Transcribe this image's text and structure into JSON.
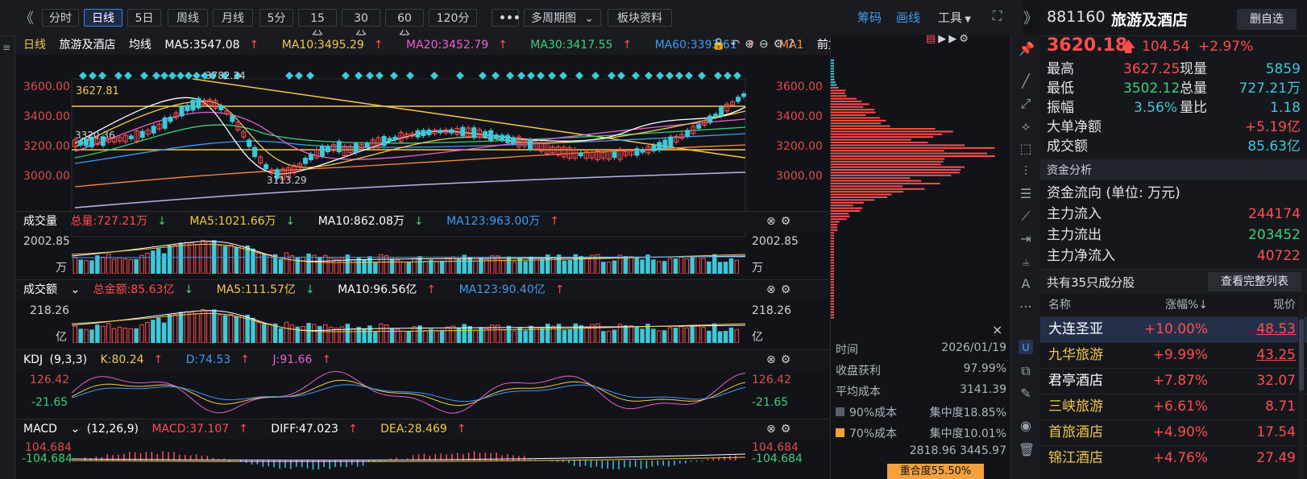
{
  "toolbar": {
    "period_tabs": [
      "分时",
      "日线",
      "5日",
      "周线",
      "月线",
      "5分",
      "15分",
      "30分",
      "60分",
      "120分"
    ],
    "active_tab": "日线",
    "more_label": "•••",
    "multi_period_label": "多周期图",
    "sector_info_label": "板块资料",
    "chips_label": "筹码",
    "drawline_label": "画线",
    "tools_label": "工具"
  },
  "main_chart": {
    "period_label": "日线",
    "name": "旅游及酒店",
    "ma_mode_label": "均线",
    "ma": [
      {
        "label": "MA5:3547.08",
        "color": "#ffffff"
      },
      {
        "label": "MA10:3495.29",
        "color": "#f2c94c"
      },
      {
        "label": "MA20:3452.79",
        "color": "#e960d2"
      },
      {
        "label": "MA30:3417.55",
        "color": "#3cd07a"
      },
      {
        "label": "MA60:3393.61",
        "color": "#3e9bf0"
      },
      {
        "label": "MA1",
        "color": "#ff8a3c"
      }
    ],
    "adjust_label": "前复权",
    "price_axis": [
      "3600.00",
      "3400.00",
      "3200.00",
      "3000.00"
    ],
    "high_annot": "3782.24",
    "low_annot": "3113.29",
    "hline_label": "3627.81",
    "left_annot": "3320.36"
  },
  "volume_panel": {
    "title": "成交量",
    "total": "总量:727.21万",
    "ma5": "MA5:1021.66万",
    "ma10": "MA10:862.08万",
    "ma123": "MA123:963.00万",
    "axis_top": "2002.85",
    "axis_unit": "万"
  },
  "amount_panel": {
    "title": "成交额",
    "total": "总金额:85.63亿",
    "ma5": "MA5:111.57亿",
    "ma10": "MA10:96.56亿",
    "ma123": "MA123:90.40亿",
    "axis_top": "218.26",
    "axis_unit": "亿"
  },
  "kdj_panel": {
    "title": "KDJ",
    "params": "(9,3,3)",
    "k": "K:80.24",
    "d": "D:74.53",
    "j": "J:91.66",
    "axis_top": "126.42",
    "axis_bottom": "-21.65"
  },
  "macd_panel": {
    "title": "MACD",
    "params": "(12,26,9)",
    "macd": "MACD:37.107",
    "diff": "DIFF:47.023",
    "dea": "DEA:28.469",
    "axis_top": "104.684",
    "axis_bottom": "-104.684"
  },
  "chip_panel": {
    "close_label": "×",
    "time_label": "时间",
    "time_value": "2026/01/19",
    "profit_label": "收盘获利",
    "profit_value": "97.99%",
    "avg_cost_label": "平均成本",
    "avg_cost_value": "3141.39",
    "cost90_label": "90%成本",
    "cost90_value": "集中度18.85%",
    "cost70_label": "70%成本",
    "cost70_value": "集中度10.01%",
    "range_value": "2818.96 3445.97",
    "overlap_value": "重合度55.50%"
  },
  "quote": {
    "code": "881160",
    "name": "旅游及酒店",
    "del_fav_label": "删自选",
    "price": "3620.18",
    "change": "104.54",
    "pct": "+2.97%",
    "stats": [
      {
        "k": "最高",
        "v": "3627.25",
        "k2": "现量",
        "v2": "5859"
      },
      {
        "k": "最低",
        "v": "3502.12",
        "k2": "总量",
        "v2": "727.21万"
      },
      {
        "k": "振幅",
        "v": "3.56%",
        "k2": "量比",
        "v2": "1.18"
      }
    ],
    "net_big_label": "大单净额",
    "net_big_value": "+5.19亿",
    "turnover_label": "成交额",
    "turnover_value": "85.63亿"
  },
  "fund": {
    "tab_label": "资金分析",
    "flow_title": "资金流向 (单位: 万元)",
    "inflow_label": "主力流入",
    "inflow_value": "244174",
    "outflow_label": "主力流出",
    "outflow_value": "203452",
    "net_label": "主力净流入",
    "net_value": "40722"
  },
  "constituents": {
    "count_label": "共有35只成分股",
    "view_all_label": "查看完整列表",
    "col_name": "名称",
    "col_pct": "涨幅%",
    "col_price": "现价",
    "rows": [
      {
        "name": "大连圣亚",
        "pct": "+10.00%",
        "price": "48.53"
      },
      {
        "name": "九华旅游",
        "pct": "+9.99%",
        "price": "43.25"
      },
      {
        "name": "君亭酒店",
        "pct": "+7.87%",
        "price": "32.07"
      },
      {
        "name": "三峡旅游",
        "pct": "+6.61%",
        "price": "8.71"
      },
      {
        "name": "首旅酒店",
        "pct": "+4.90%",
        "price": "17.54"
      },
      {
        "name": "锦江酒店",
        "pct": "+4.76%",
        "price": "27.49"
      }
    ]
  }
}
